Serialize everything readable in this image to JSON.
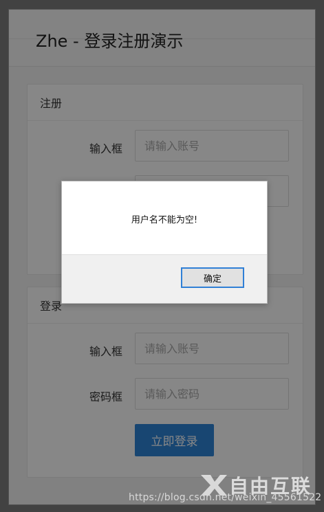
{
  "header": {
    "title": "Zhe - 登录注册演示"
  },
  "register": {
    "title": "注册",
    "account_label": "输入框",
    "account_placeholder": "请输入账号"
  },
  "login": {
    "title": "登录",
    "account_label": "输入框",
    "account_placeholder": "请输入账号",
    "password_label": "密码框",
    "password_placeholder": "请输入密码",
    "submit_label": "立即登录"
  },
  "alert": {
    "message": "用户名不能为空!",
    "ok_label": "确定"
  },
  "watermark": {
    "logo_text": "自由互联",
    "url": "https://blog.csdn.net/weixin_45561522"
  },
  "colors": {
    "primary": "#2f84d8",
    "overlay": "#7d7d7d"
  }
}
